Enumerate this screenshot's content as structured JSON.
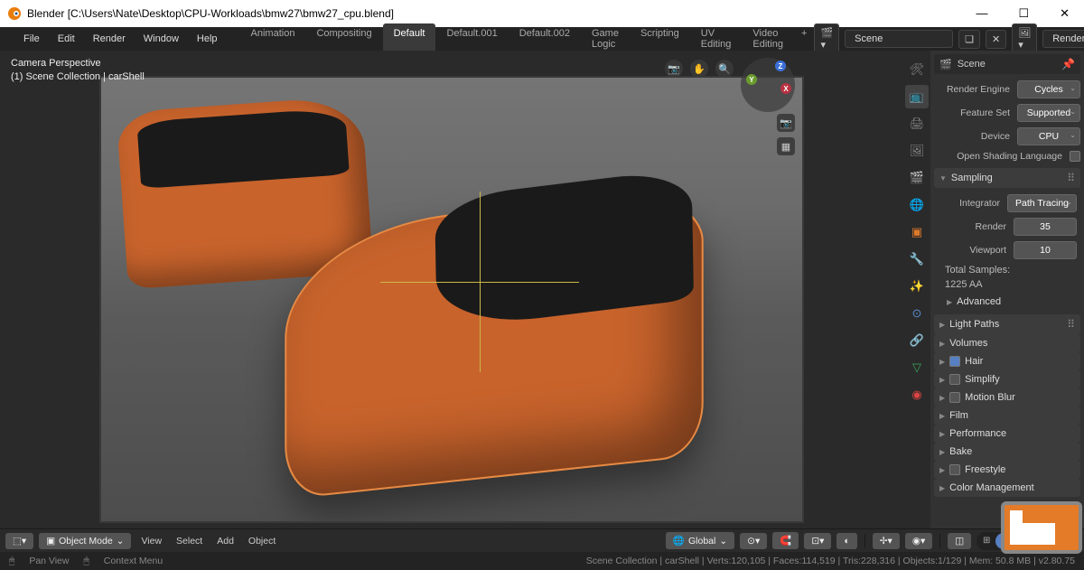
{
  "titlebar": {
    "title": "Blender [C:\\Users\\Nate\\Desktop\\CPU-Workloads\\bmw27\\bmw27_cpu.blend]"
  },
  "menu": {
    "file": "File",
    "edit": "Edit",
    "render": "Render",
    "window": "Window",
    "help": "Help"
  },
  "workspaces": {
    "tabs": [
      "Animation",
      "Compositing",
      "Default",
      "Default.001",
      "Default.002",
      "Game Logic",
      "Scripting",
      "UV Editing",
      "Video Editing"
    ],
    "active": "Default"
  },
  "top_right": {
    "scene": "Scene",
    "layer": "RenderLayer"
  },
  "viewport_info": {
    "camera": "Camera Perspective",
    "collection": "(1) Scene Collection | carShell"
  },
  "nav_axes": {
    "x": "X",
    "y": "Y",
    "z": "Z"
  },
  "header": {
    "mode": "Object Mode",
    "view": "View",
    "select": "Select",
    "add": "Add",
    "object": "Object",
    "orient": "Global"
  },
  "props": {
    "scene_name": "Scene",
    "render_engine_label": "Render Engine",
    "render_engine": "Cycles",
    "feature_set_label": "Feature Set",
    "feature_set": "Supported",
    "device_label": "Device",
    "device": "CPU",
    "osl": "Open Shading Language",
    "sampling_hdr": "Sampling",
    "integrator_label": "Integrator",
    "integrator": "Path Tracing",
    "render_label": "Render",
    "render_samples": "35",
    "viewport_label": "Viewport",
    "viewport_samples": "10",
    "total_samples_label": "Total Samples:",
    "total_samples": "1225 AA",
    "advanced": "Advanced",
    "sections": {
      "light_paths": "Light Paths",
      "volumes": "Volumes",
      "hair": "Hair",
      "simplify": "Simplify",
      "motion_blur": "Motion Blur",
      "film": "Film",
      "performance": "Performance",
      "bake": "Bake",
      "freestyle": "Freestyle",
      "color_mgmt": "Color Management"
    }
  },
  "status": {
    "pan": "Pan View",
    "context": "Context Menu",
    "stats": "Scene Collection | carShell | Verts:120,105 | Faces:114,519 | Tris:228,316 | Objects:1/129 | Mem: 50.8 MB | v2.80.75"
  }
}
